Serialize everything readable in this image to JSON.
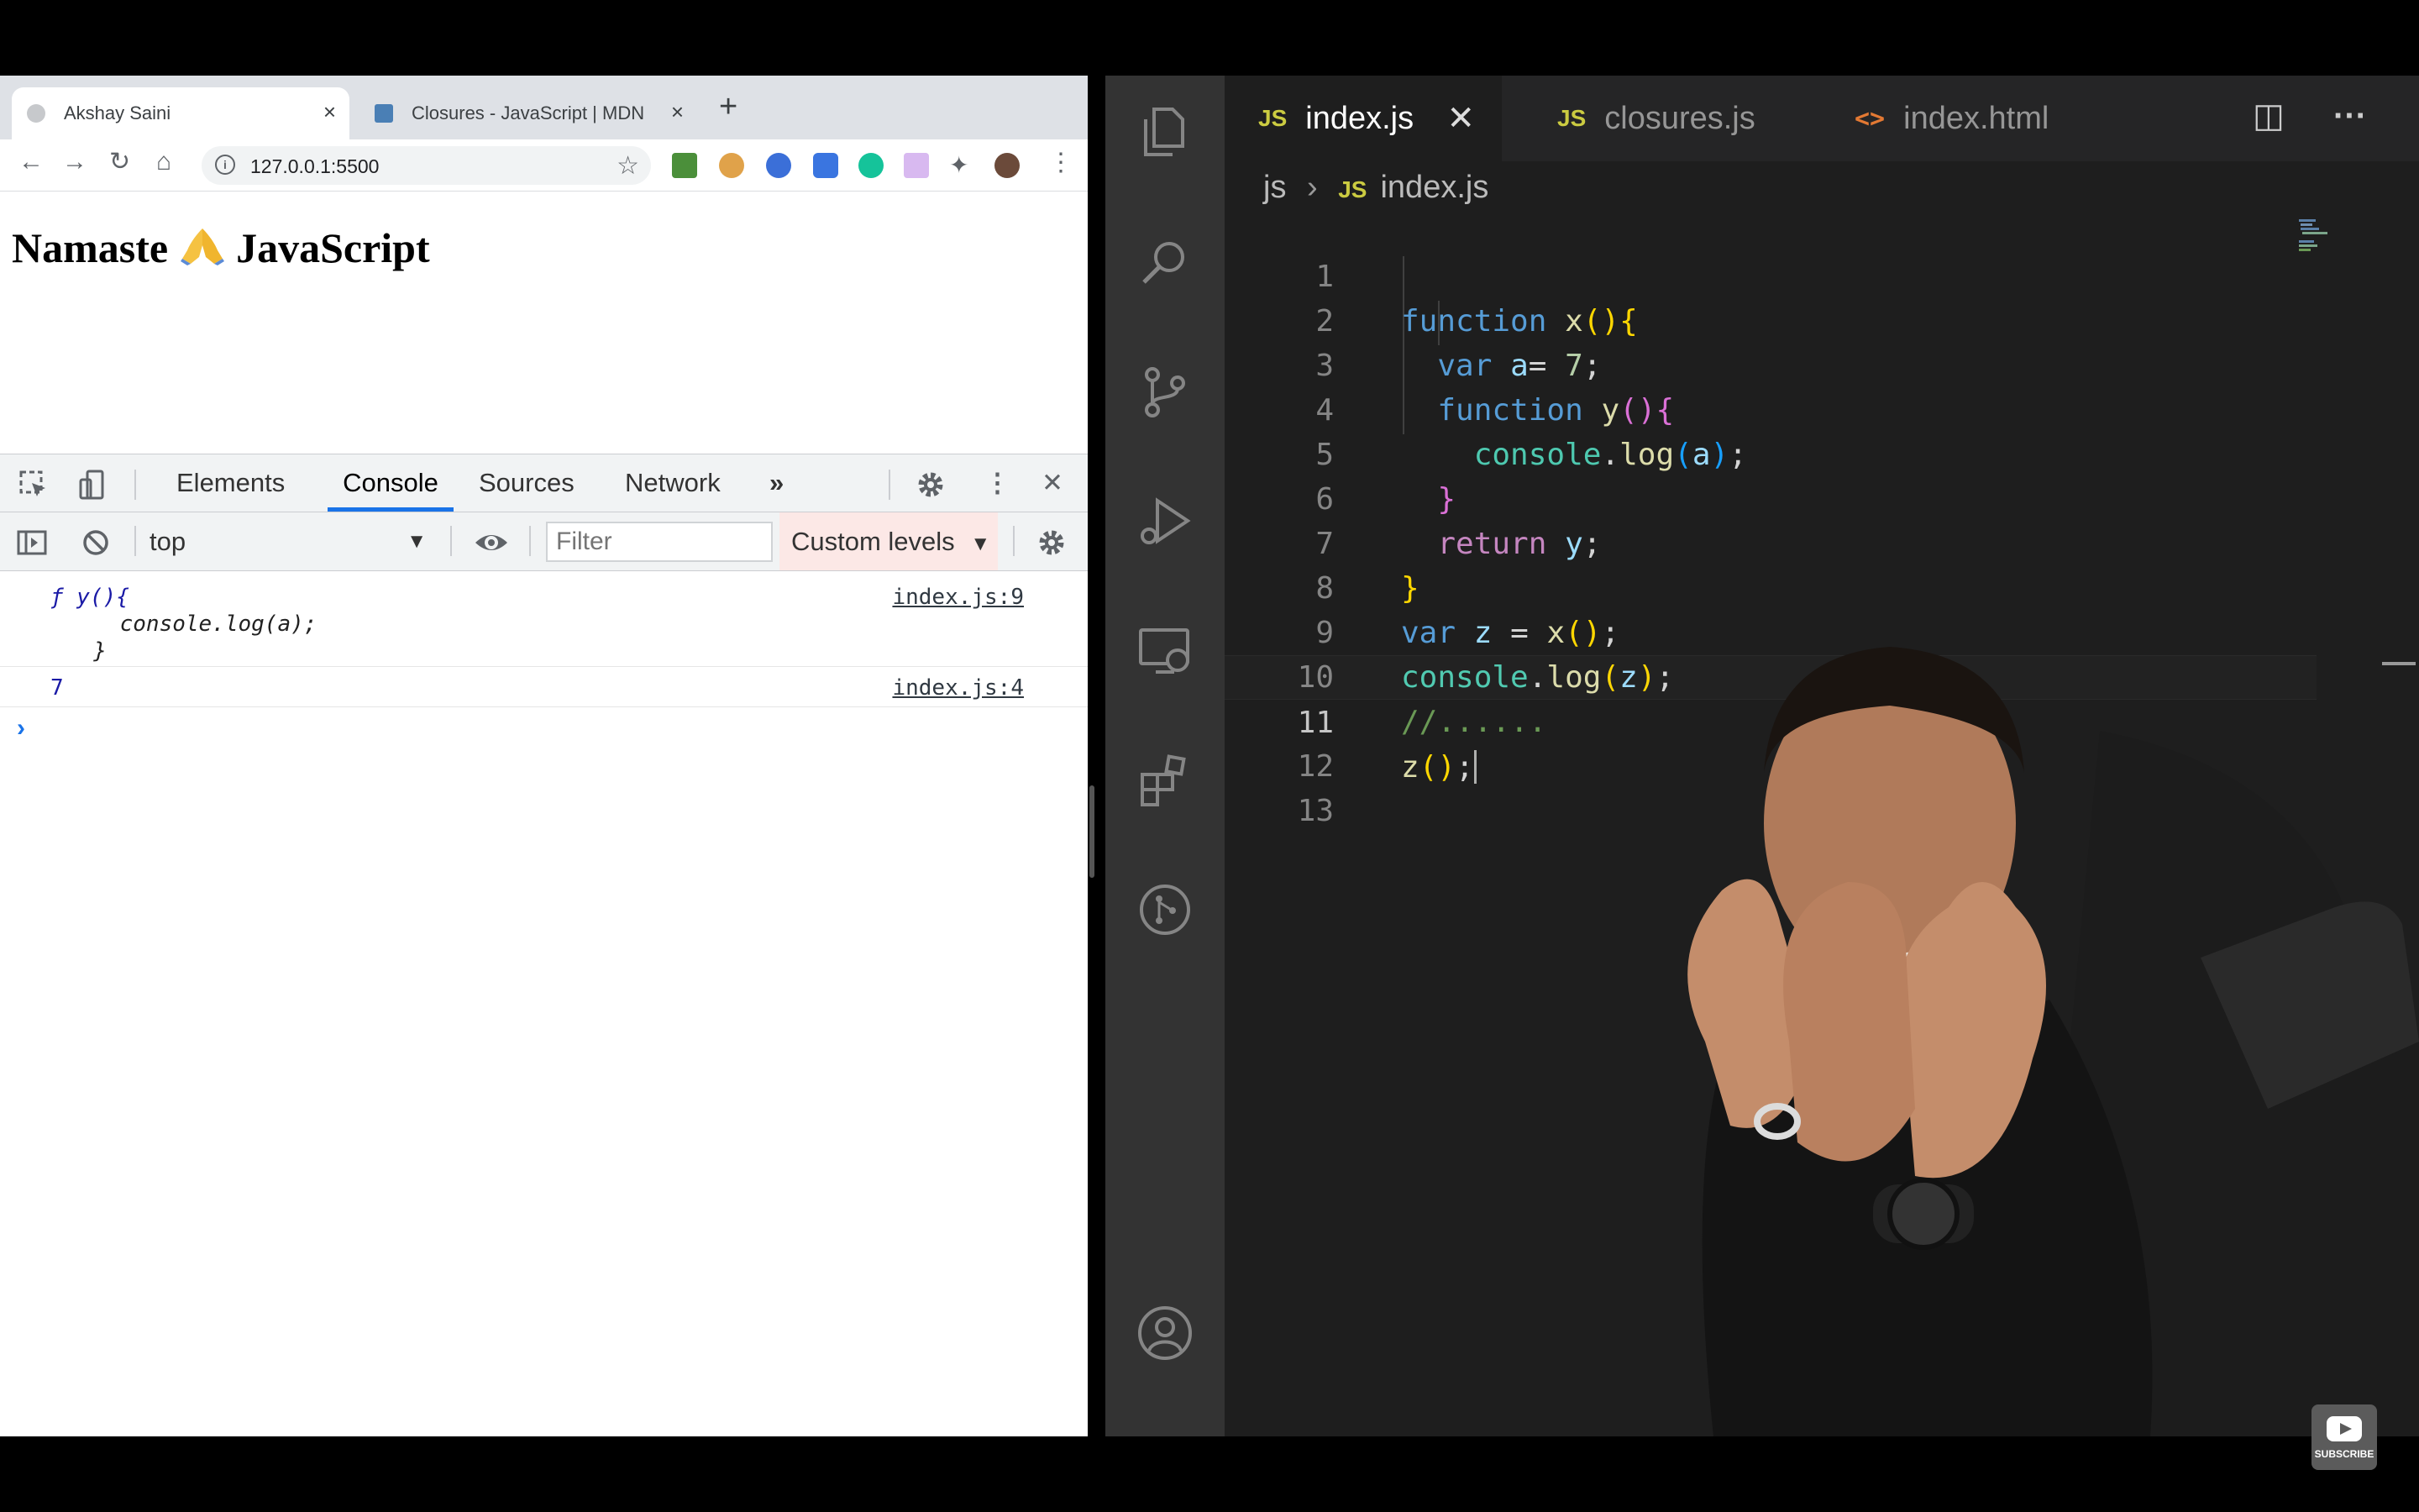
{
  "browser": {
    "tabs": [
      {
        "title": "Akshay Saini",
        "active": true
      },
      {
        "title": "Closures - JavaScript | MDN",
        "active": false
      }
    ],
    "url": "127.0.0.1:5500",
    "page_heading_prefix": "Namaste",
    "page_heading_suffix": "JavaScript"
  },
  "devtools": {
    "tabs": [
      "Elements",
      "Console",
      "Sources",
      "Network"
    ],
    "active_tab": "Console",
    "context": "top",
    "filter_placeholder": "Filter",
    "levels_label": "Custom levels",
    "entries": [
      {
        "lines": [
          "ƒ y(){",
          "    console.log(a);",
          "  }"
        ],
        "source": "index.js:9"
      },
      {
        "value": "7",
        "source": "index.js:4"
      }
    ],
    "prompt": "›"
  },
  "editor": {
    "tabs": [
      {
        "label": "index.js",
        "badge": "JS",
        "active": true
      },
      {
        "label": "closures.js",
        "badge": "JS",
        "active": false
      },
      {
        "label": "index.html",
        "badge": "<>",
        "active": false
      }
    ],
    "breadcrumb": {
      "folder": "js",
      "badge": "JS",
      "file": "index.js"
    },
    "line_numbers": [
      "1",
      "2",
      "3",
      "4",
      "5",
      "6",
      "7",
      "8",
      "9",
      "10",
      "11",
      "12",
      "13"
    ],
    "current_line": 11
  },
  "youtube": {
    "subscribe_label": "SUBSCRIBE"
  },
  "colors": {
    "vscode_bg": "#1e1e1e",
    "activity_bar": "#333333",
    "devtools_accent": "#1a73e8",
    "js_badge": "#cbcb41"
  }
}
